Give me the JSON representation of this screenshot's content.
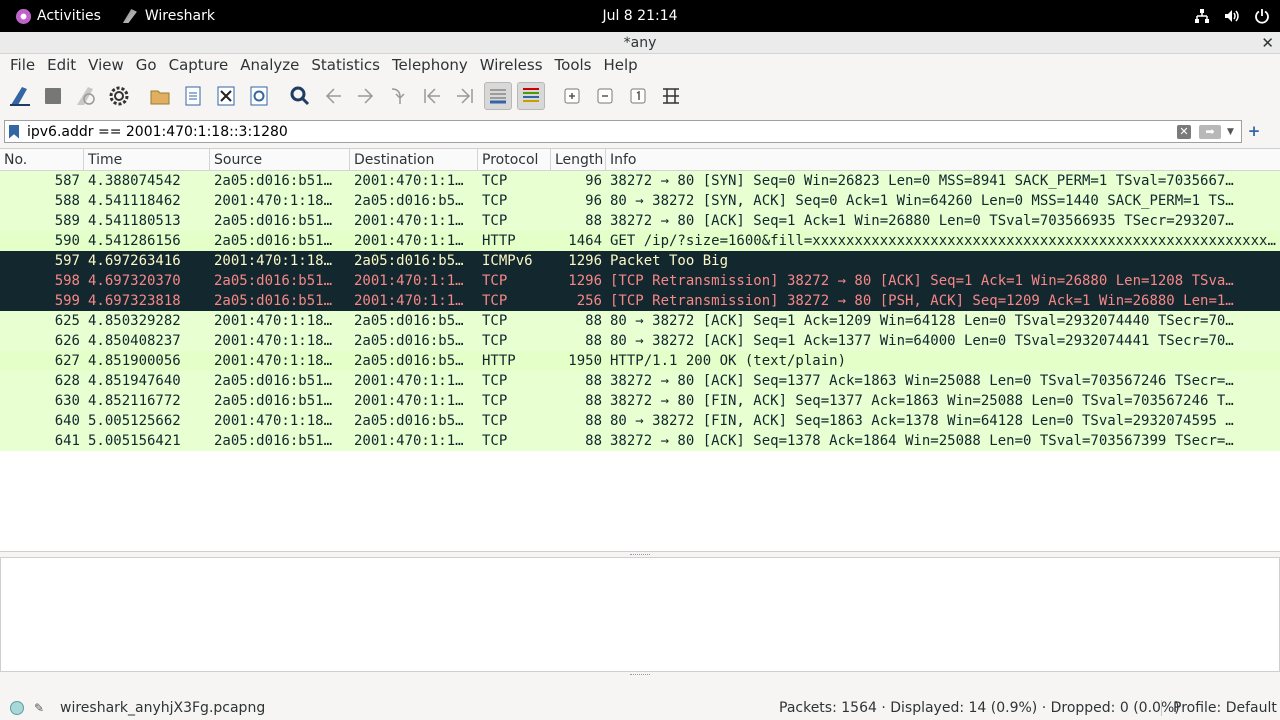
{
  "topbar": {
    "activities": "Activities",
    "app": "Wireshark",
    "clock": "Jul 8  21:14",
    "icons": [
      "network-icon",
      "volume-icon",
      "power-icon"
    ]
  },
  "window": {
    "title": "*any"
  },
  "menu": [
    "File",
    "Edit",
    "View",
    "Go",
    "Capture",
    "Analyze",
    "Statistics",
    "Telephony",
    "Wireless",
    "Tools",
    "Help"
  ],
  "filter": {
    "value": "ipv6.addr == 2001:470:1:18::3:1280"
  },
  "columns": {
    "no": "No.",
    "time": "Time",
    "source": "Source",
    "destination": "Destination",
    "protocol": "Protocol",
    "length": "Length",
    "info": "Info"
  },
  "packets": [
    {
      "no": "587",
      "time": "4.388074542",
      "src": "2a05:d016:b51…",
      "dst": "2001:470:1:1…",
      "proto": "TCP",
      "len": "96",
      "info": "38272 → 80 [SYN] Seq=0 Win=26823 Len=0 MSS=8941 SACK_PERM=1 TSval=7035667…",
      "style": "tcp"
    },
    {
      "no": "588",
      "time": "4.541118462",
      "src": "2001:470:1:18…",
      "dst": "2a05:d016:b5…",
      "proto": "TCP",
      "len": "96",
      "info": "80 → 38272 [SYN, ACK] Seq=0 Ack=1 Win=64260 Len=0 MSS=1440 SACK_PERM=1 TS…",
      "style": "tcp"
    },
    {
      "no": "589",
      "time": "4.541180513",
      "src": "2a05:d016:b51…",
      "dst": "2001:470:1:1…",
      "proto": "TCP",
      "len": "88",
      "info": "38272 → 80 [ACK] Seq=1 Ack=1 Win=26880 Len=0 TSval=703566935 TSecr=293207…",
      "style": "tcp"
    },
    {
      "no": "590",
      "time": "4.541286156",
      "src": "2a05:d016:b51…",
      "dst": "2001:470:1:1…",
      "proto": "HTTP",
      "len": "1464",
      "info": "GET /ip/?size=1600&fill=xxxxxxxxxxxxxxxxxxxxxxxxxxxxxxxxxxxxxxxxxxxxxxxxxxxxxx…",
      "style": "http"
    },
    {
      "no": "597",
      "time": "4.697263416",
      "src": "2001:470:1:18…",
      "dst": "2a05:d016:b5…",
      "proto": "ICMPv6",
      "len": "1296",
      "info": "Packet Too Big",
      "style": "icmp"
    },
    {
      "no": "598",
      "time": "4.697320370",
      "src": "2a05:d016:b51…",
      "dst": "2001:470:1:1…",
      "proto": "TCP",
      "len": "1296",
      "info": "[TCP Retransmission] 38272 → 80 [ACK] Seq=1 Ack=1 Win=26880 Len=1208 TSva…",
      "style": "retr"
    },
    {
      "no": "599",
      "time": "4.697323818",
      "src": "2a05:d016:b51…",
      "dst": "2001:470:1:1…",
      "proto": "TCP",
      "len": "256",
      "info": "[TCP Retransmission] 38272 → 80 [PSH, ACK] Seq=1209 Ack=1 Win=26880 Len=1…",
      "style": "retr"
    },
    {
      "no": "625",
      "time": "4.850329282",
      "src": "2001:470:1:18…",
      "dst": "2a05:d016:b5…",
      "proto": "TCP",
      "len": "88",
      "info": "80 → 38272 [ACK] Seq=1 Ack=1209 Win=64128 Len=0 TSval=2932074440 TSecr=70…",
      "style": "tcp"
    },
    {
      "no": "626",
      "time": "4.850408237",
      "src": "2001:470:1:18…",
      "dst": "2a05:d016:b5…",
      "proto": "TCP",
      "len": "88",
      "info": "80 → 38272 [ACK] Seq=1 Ack=1377 Win=64000 Len=0 TSval=2932074441 TSecr=70…",
      "style": "tcp"
    },
    {
      "no": "627",
      "time": "4.851900056",
      "src": "2001:470:1:18…",
      "dst": "2a05:d016:b5…",
      "proto": "HTTP",
      "len": "1950",
      "info": "HTTP/1.1 200 OK  (text/plain)",
      "style": "http"
    },
    {
      "no": "628",
      "time": "4.851947640",
      "src": "2a05:d016:b51…",
      "dst": "2001:470:1:1…",
      "proto": "TCP",
      "len": "88",
      "info": "38272 → 80 [ACK] Seq=1377 Ack=1863 Win=25088 Len=0 TSval=703567246 TSecr=…",
      "style": "tcp"
    },
    {
      "no": "630",
      "time": "4.852116772",
      "src": "2a05:d016:b51…",
      "dst": "2001:470:1:1…",
      "proto": "TCP",
      "len": "88",
      "info": "38272 → 80 [FIN, ACK] Seq=1377 Ack=1863 Win=25088 Len=0 TSval=703567246 T…",
      "style": "tcp"
    },
    {
      "no": "640",
      "time": "5.005125662",
      "src": "2001:470:1:18…",
      "dst": "2a05:d016:b5…",
      "proto": "TCP",
      "len": "88",
      "info": "80 → 38272 [FIN, ACK] Seq=1863 Ack=1378 Win=64128 Len=0 TSval=2932074595 …",
      "style": "tcp"
    },
    {
      "no": "641",
      "time": "5.005156421",
      "src": "2a05:d016:b51…",
      "dst": "2001:470:1:1…",
      "proto": "TCP",
      "len": "88",
      "info": "38272 → 80 [ACK] Seq=1378 Ack=1864 Win=25088 Len=0 TSval=703567399 TSecr=…",
      "style": "tcp"
    }
  ],
  "status": {
    "file": "wireshark_anyhjX3Fg.pcapng",
    "packets": "Packets: 1564 · Displayed: 14 (0.9%) · Dropped: 0 (0.0%)",
    "profile": "Profile: Default"
  },
  "colors": {
    "tcp_bg": "#e7ffd1",
    "http_bg": "#e4ffc7",
    "bad_bg": "#12272e",
    "icmp_fg": "#fdf9c6",
    "retr_fg": "#f78787"
  }
}
